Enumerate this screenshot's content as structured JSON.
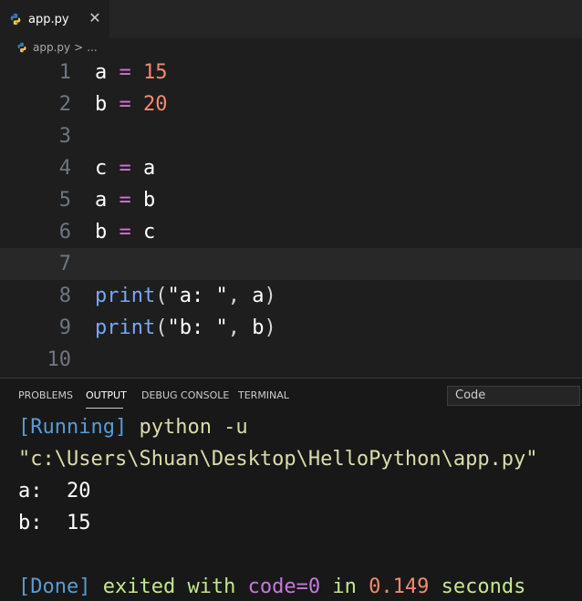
{
  "tab": {
    "label": "app.py",
    "close_glyph": "✕",
    "icon": "python-icon"
  },
  "breadcrumb": {
    "file": "app.py",
    "separator": ">",
    "more": "..."
  },
  "editor": {
    "current_line": 7,
    "lines": [
      {
        "n": "1",
        "tokens": [
          {
            "t": "a",
            "c": "var"
          },
          {
            "t": " ",
            "c": "var"
          },
          {
            "t": "=",
            "c": "op"
          },
          {
            "t": " ",
            "c": "var"
          },
          {
            "t": "15",
            "c": "num"
          }
        ]
      },
      {
        "n": "2",
        "tokens": [
          {
            "t": "b",
            "c": "var"
          },
          {
            "t": " ",
            "c": "var"
          },
          {
            "t": "=",
            "c": "op"
          },
          {
            "t": " ",
            "c": "var"
          },
          {
            "t": "20",
            "c": "num"
          }
        ]
      },
      {
        "n": "3",
        "tokens": []
      },
      {
        "n": "4",
        "tokens": [
          {
            "t": "c",
            "c": "var"
          },
          {
            "t": " ",
            "c": "var"
          },
          {
            "t": "=",
            "c": "op"
          },
          {
            "t": " ",
            "c": "var"
          },
          {
            "t": "a",
            "c": "var"
          }
        ]
      },
      {
        "n": "5",
        "tokens": [
          {
            "t": "a",
            "c": "var"
          },
          {
            "t": " ",
            "c": "var"
          },
          {
            "t": "=",
            "c": "op"
          },
          {
            "t": " ",
            "c": "var"
          },
          {
            "t": "b",
            "c": "var"
          }
        ]
      },
      {
        "n": "6",
        "tokens": [
          {
            "t": "b",
            "c": "var"
          },
          {
            "t": " ",
            "c": "var"
          },
          {
            "t": "=",
            "c": "op"
          },
          {
            "t": " ",
            "c": "var"
          },
          {
            "t": "c",
            "c": "var"
          }
        ]
      },
      {
        "n": "7",
        "tokens": []
      },
      {
        "n": "8",
        "tokens": [
          {
            "t": "print",
            "c": "fn"
          },
          {
            "t": "(",
            "c": "paren"
          },
          {
            "t": "\"a: \"",
            "c": "str"
          },
          {
            "t": ", ",
            "c": "punc"
          },
          {
            "t": "a",
            "c": "var"
          },
          {
            "t": ")",
            "c": "paren"
          }
        ]
      },
      {
        "n": "9",
        "tokens": [
          {
            "t": "print",
            "c": "fn"
          },
          {
            "t": "(",
            "c": "paren"
          },
          {
            "t": "\"b: \"",
            "c": "str"
          },
          {
            "t": ", ",
            "c": "punc"
          },
          {
            "t": "b",
            "c": "var"
          },
          {
            "t": ")",
            "c": "paren"
          }
        ]
      },
      {
        "n": "10",
        "tokens": []
      }
    ]
  },
  "panel": {
    "tabs": [
      {
        "label": "PROBLEMS",
        "active": false
      },
      {
        "label": "OUTPUT",
        "active": true
      },
      {
        "label": "DEBUG CONSOLE",
        "active": false
      },
      {
        "label": "TERMINAL",
        "active": false
      }
    ],
    "output_channel": "Code",
    "output": {
      "running_tag": "[Running]",
      "running_cmd": " python -u",
      "path": "\"c:\\Users\\Shuan\\Desktop\\HelloPython\\app.py\"",
      "line_a": "a:  20",
      "line_b": "b:  15",
      "done_tag": "[Done]",
      "done_exited": " exited with ",
      "done_code": "code=0",
      "done_in": " in ",
      "done_time": "0.149",
      "done_seconds": " seconds"
    }
  },
  "colors": {
    "background": "#1e1e1e",
    "panel_background": "#181818",
    "keyword": "#d670d6",
    "number": "#f28b6e",
    "function": "#79a7f8"
  }
}
